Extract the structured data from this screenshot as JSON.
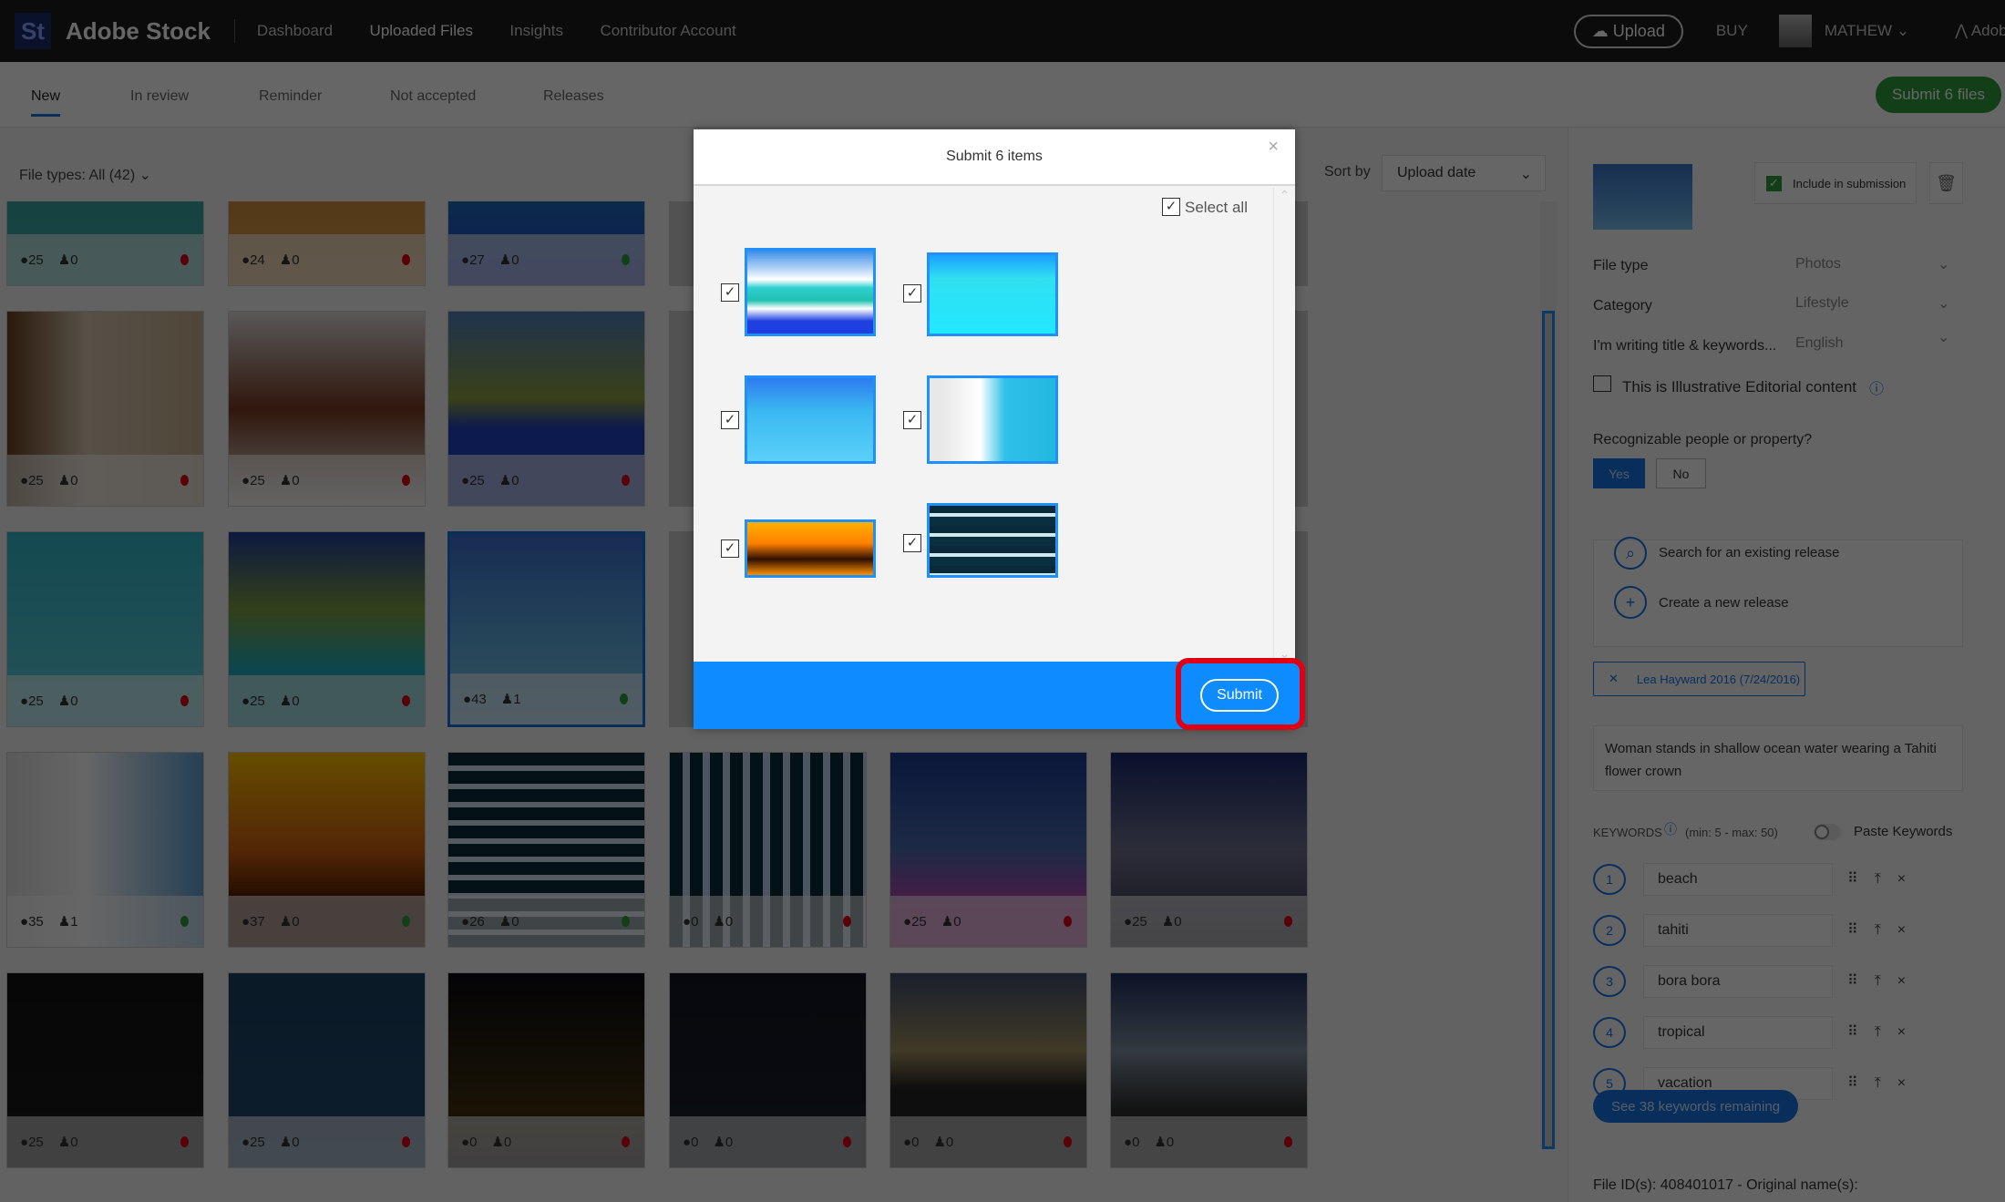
{
  "header": {
    "logo": "St",
    "brand": "Adobe Stock",
    "nav": [
      "Dashboard",
      "Uploaded Files",
      "Insights",
      "Contributor Account"
    ],
    "active_nav": 1,
    "upload": "Upload",
    "buy": "BUY",
    "user": "MATHEW",
    "adobe": "Adobe"
  },
  "tabs": {
    "items": [
      "New",
      "In review",
      "Reminder",
      "Not accepted",
      "Releases"
    ],
    "active": 0,
    "submit_files": "Submit 6 files"
  },
  "toolbar": {
    "file_types": "File types: All (42)",
    "sort_label": "Sort by",
    "sort_value": "Upload date"
  },
  "grid": {
    "tiles": [
      {
        "kw": "25",
        "people": "0",
        "status": "red"
      },
      {
        "kw": "24",
        "people": "0",
        "status": "red"
      },
      {
        "kw": "27",
        "people": "0",
        "status": "green"
      },
      {
        "kw": "",
        "people": "",
        "status": ""
      },
      {
        "kw": "",
        "people": "",
        "status": ""
      },
      {
        "kw": "",
        "people": "",
        "status": ""
      },
      {
        "kw": "25",
        "people": "0",
        "status": "red"
      },
      {
        "kw": "25",
        "people": "0",
        "status": "red"
      },
      {
        "kw": "25",
        "people": "0",
        "status": "red"
      },
      {
        "kw": "",
        "people": "",
        "status": ""
      },
      {
        "kw": "",
        "people": "",
        "status": ""
      },
      {
        "kw": "",
        "people": "",
        "status": ""
      },
      {
        "kw": "25",
        "people": "0",
        "status": "red"
      },
      {
        "kw": "25",
        "people": "0",
        "status": "red"
      },
      {
        "kw": "43",
        "people": "1",
        "status": "green",
        "selected": true
      },
      {
        "kw": "",
        "people": "",
        "status": ""
      },
      {
        "kw": "",
        "people": "",
        "status": ""
      },
      {
        "kw": "",
        "people": "",
        "status": ""
      },
      {
        "kw": "35",
        "people": "1",
        "status": "green"
      },
      {
        "kw": "37",
        "people": "0",
        "status": "green"
      },
      {
        "kw": "26",
        "people": "0",
        "status": "green"
      },
      {
        "kw": "0",
        "people": "0",
        "status": "red"
      },
      {
        "kw": "25",
        "people": "0",
        "status": "red"
      },
      {
        "kw": "25",
        "people": "0",
        "status": "red"
      },
      {
        "kw": "25",
        "people": "0",
        "status": "red"
      },
      {
        "kw": "25",
        "people": "0",
        "status": "red"
      },
      {
        "kw": "0",
        "people": "0",
        "status": "red"
      },
      {
        "kw": "0",
        "people": "0",
        "status": "red"
      },
      {
        "kw": "0",
        "people": "0",
        "status": "red"
      },
      {
        "kw": "0",
        "people": "0",
        "status": "red"
      }
    ],
    "status_colors": {
      "red": "#e00014",
      "green": "#2d9d3c"
    }
  },
  "panel": {
    "include": "Include in submission",
    "file_type_label": "File type",
    "file_type_value": "Photos",
    "category_label": "Category",
    "category_value": "Lifestyle",
    "lang_label": "I'm writing title & keywords...",
    "lang_value": "English",
    "editorial": "This is Illustrative Editorial content",
    "recognizable": "Recognizable people or property?",
    "yes": "Yes",
    "no": "No",
    "search_release": "Search for an existing release",
    "create_release": "Create a new release",
    "release_tag": "Lea Hayward 2016 (7/24/2016)",
    "title": "Woman stands in shallow ocean water wearing a Tahiti flower crown",
    "keywords_label": "KEYWORDS",
    "keywords_range": "(min: 5 - max: 50)",
    "paste_keywords": "Paste Keywords",
    "keywords": [
      "beach",
      "tahiti",
      "bora bora",
      "tropical",
      "vacation"
    ],
    "see_more": "See 38 keywords remaining",
    "file_id": "File ID(s): 408401017 - Original name(s):"
  },
  "modal": {
    "title": "Submit 6 items",
    "select_all": "Select all",
    "items_checked": [
      true,
      true,
      true,
      true,
      true,
      true
    ],
    "submit": "Submit"
  },
  "colors": {
    "accent": "#1473e6",
    "footer": "#0d8bff",
    "highlight": "#e00014",
    "green": "#2d9d3c"
  }
}
